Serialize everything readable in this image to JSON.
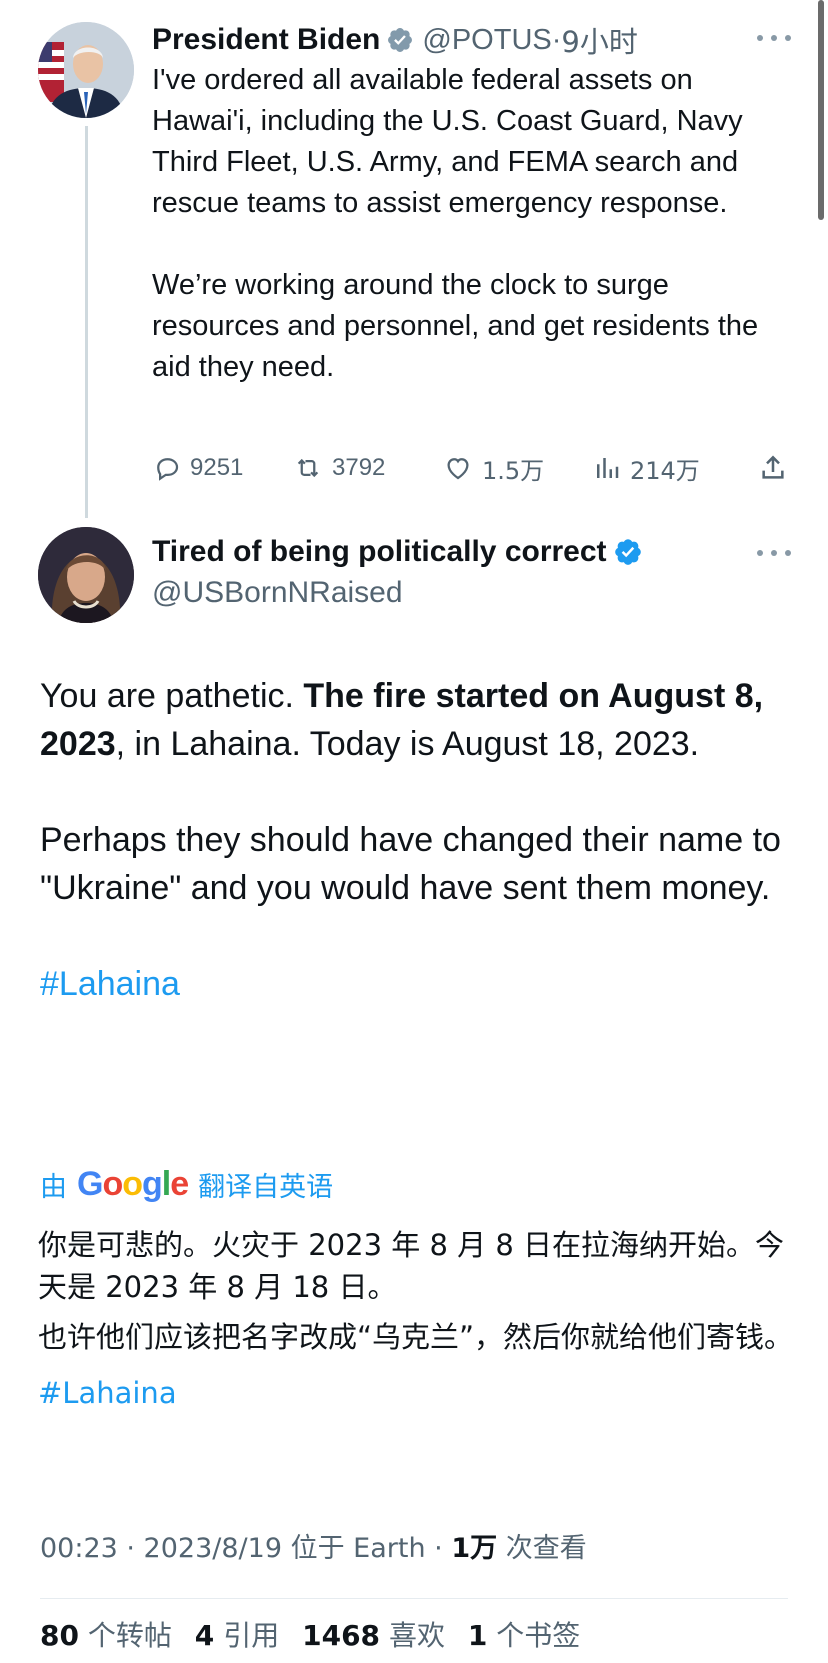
{
  "parent_tweet": {
    "author_name": "President Biden",
    "handle": "@POTUS",
    "separator": "·",
    "time": "9小时",
    "text_p1": "I've ordered all available federal assets on Hawai'i, including the U.S. Coast Guard, Navy Third Fleet, U.S. Army, and FEMA search and rescue teams to assist emergency response.",
    "text_p2": "We’re working around the clock to surge resources and personnel, and get residents the aid they need.",
    "replies": "9251",
    "retweets": "3792",
    "likes": "1.5万",
    "views": "214万"
  },
  "reply_tweet": {
    "author_name": "Tired of being politically correct",
    "handle": "@USBornNRaised",
    "text_p1_plain1": "You are pathetic. ",
    "text_p1_bold": "The fire started on August 8, 2023",
    "text_p1_plain2": ", in Lahaina.  Today is August 18, 2023.",
    "text_p2": "Perhaps they should have changed their name to \"Ukraine\" and you would have sent them money.",
    "hashtag": "#Lahaina"
  },
  "translation": {
    "prefix": "由",
    "provider": "Google",
    "suffix": "翻译自英语",
    "text_p1": "你是可悲的。火灾于 2023 年 8 月 8 日在拉海纳开始。今天是 2023 年 8 月 18 日。",
    "text_p2": "也许他们应该把名字改成“乌克兰”，然后你就给他们寄钱。",
    "hashtag": "#Lahaina"
  },
  "meta": {
    "timestamp": "00:23 · 2023/8/19 位于 Earth · ",
    "views_count": "1万",
    "views_label": " 次查看"
  },
  "stats": {
    "reposts_count": "80",
    "reposts_label": "个转帖",
    "quotes_count": "4",
    "quotes_label": "引用",
    "likes_count": "1468",
    "likes_label": "喜欢",
    "bookmarks_count": "1",
    "bookmarks_label": "个书签"
  },
  "colors": {
    "accent": "#1d9bf0",
    "text": "#0f1419",
    "secondary": "#536471"
  }
}
